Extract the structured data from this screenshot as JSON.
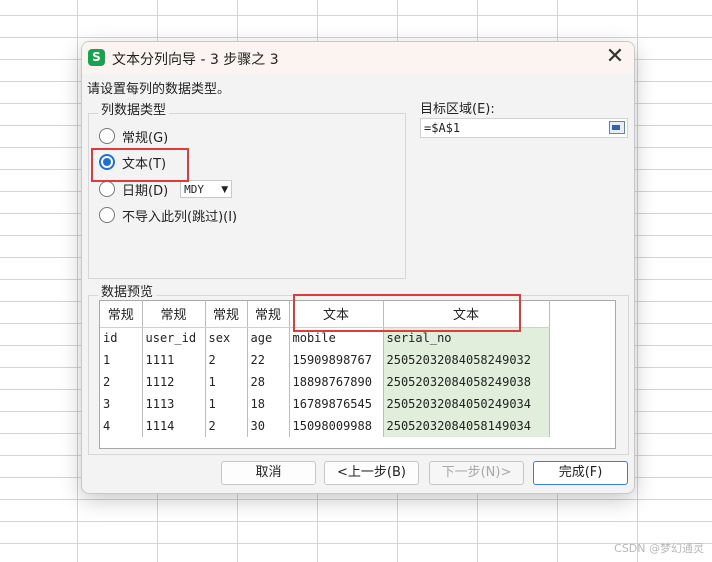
{
  "dialog": {
    "title": "文本分列向导 - 3 步骤之 3",
    "app_icon_letter": "S",
    "close_glyph": "✕",
    "instruction": "请设置每列的数据类型。"
  },
  "column_format": {
    "legend": "列数据类型",
    "options": [
      {
        "label": "常规(G)",
        "checked": false
      },
      {
        "label": "文本(T)",
        "checked": true
      },
      {
        "label": "日期(D)",
        "checked": false
      },
      {
        "label": "不导入此列(跳过)(I)",
        "checked": false
      }
    ],
    "date_format_value": "MDY"
  },
  "destination": {
    "label": "目标区域(E):",
    "value": "=$A$1"
  },
  "preview": {
    "legend": "数据预览",
    "column_types": [
      "常规",
      "常规",
      "常规",
      "常规",
      "文本",
      "文本"
    ],
    "rows": [
      [
        "id",
        "user_id",
        "sex",
        "age",
        "mobile",
        "serial_no"
      ],
      [
        "1",
        "1111",
        "2",
        "22",
        "15909898767",
        "25052032084058249032"
      ],
      [
        "2",
        "1112",
        "1",
        "28",
        "18898767890",
        "25052032084058249038"
      ],
      [
        "3",
        "1113",
        "1",
        "18",
        "16789876545",
        "25052032084050249034"
      ],
      [
        "4",
        "1114",
        "2",
        "30",
        "15098009988",
        "25052032084058149034"
      ]
    ]
  },
  "buttons": {
    "cancel": "取消",
    "back": "<上一步(B)",
    "next": "下一步(N)>",
    "finish": "完成(F)"
  },
  "watermark": "CSDN @梦幻通灵",
  "colors": {
    "accent": "#1e6fd9",
    "highlight_outline": "#e03a3a",
    "text_column_fill": "#e0eedb",
    "app_icon": "#1aa24f"
  }
}
